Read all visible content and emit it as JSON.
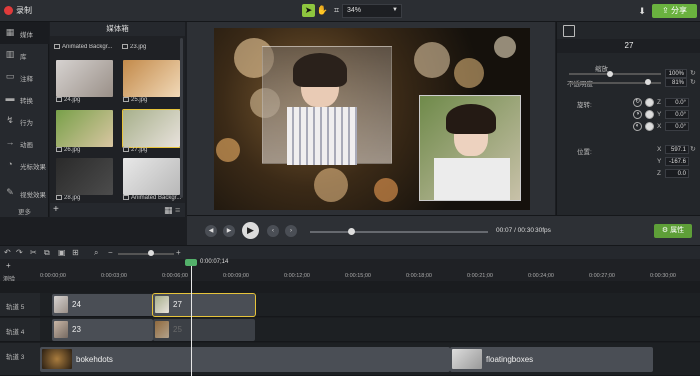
{
  "topbar": {
    "record_label": "录制",
    "zoom_value": "34%",
    "share_label": "分享",
    "icons": [
      "pointer-icon",
      "hand-icon",
      "crop-icon",
      "download-icon"
    ]
  },
  "sidebar": {
    "items": [
      {
        "label": "媒体",
        "icon": "media-icon"
      },
      {
        "label": "库",
        "icon": "library-icon"
      },
      {
        "label": "注释",
        "icon": "annotation-icon"
      },
      {
        "label": "转换",
        "icon": "transition-icon"
      },
      {
        "label": "行为",
        "icon": "behavior-icon"
      },
      {
        "label": "动画",
        "icon": "animation-icon"
      },
      {
        "label": "光标效果",
        "icon": "cursor-effect-icon"
      },
      {
        "label": "视觉效果",
        "icon": "visual-effect-icon"
      }
    ],
    "more_label": "更多"
  },
  "bin": {
    "title": "媒体箱",
    "items": [
      {
        "caption": "Animated Backgr..."
      },
      {
        "caption": "23.jpg"
      },
      {
        "caption": "24.jpg"
      },
      {
        "caption": "25.jpg"
      },
      {
        "caption": "26.jpg"
      },
      {
        "caption": "27.jpg"
      },
      {
        "caption": "28.jpg"
      },
      {
        "caption": "Animated Backgr..."
      }
    ],
    "add_icon": "plus-icon"
  },
  "properties": {
    "title": "27",
    "scale_label": "缩放",
    "scale_value": "100%",
    "opacity_label": "不透明度",
    "opacity_value": "81%",
    "rotation_label": "旋转:",
    "rot_z": "0.0°",
    "rot_y": "0.0°",
    "rot_x": "0.0°",
    "position_label": "位置:",
    "pos_x": "597.1",
    "pos_y": "-167.6",
    "pos_z": "0.0",
    "axis_x": "X",
    "axis_y": "Y",
    "axis_z": "Z",
    "button_label": "属性"
  },
  "playback": {
    "time": "00:07 / 00:30",
    "fps": "30fps",
    "progress_fraction": 0.23
  },
  "timeline": {
    "playhead_time": "0:00:07;14",
    "ruler_ticks": [
      "0:00:00;00",
      "0:00:03;00",
      "0:00:06;00",
      "0:00:09;00",
      "0:00:12;00",
      "0:00:15;00",
      "0:00:18;00",
      "0:00:21;00",
      "0:00:24;00",
      "0:00:27;00",
      "0:00:30;00"
    ],
    "marker_label": "测验",
    "tracks": [
      {
        "label": "轨道 5",
        "clips": [
          {
            "text": "24"
          },
          {
            "text": "27"
          }
        ]
      },
      {
        "label": "轨道 4",
        "clips": [
          {
            "text": "23"
          },
          {
            "text": "25"
          }
        ]
      },
      {
        "label": "轨道 3",
        "clips": [
          {
            "text": "bokehdots"
          },
          {
            "text": "floatingboxes"
          }
        ]
      }
    ]
  },
  "colors": {
    "accent_green": "#6ab23f",
    "record_red": "#e03b3b",
    "selection_yellow": "#e7c43b",
    "playhead_green": "#53b06a"
  }
}
